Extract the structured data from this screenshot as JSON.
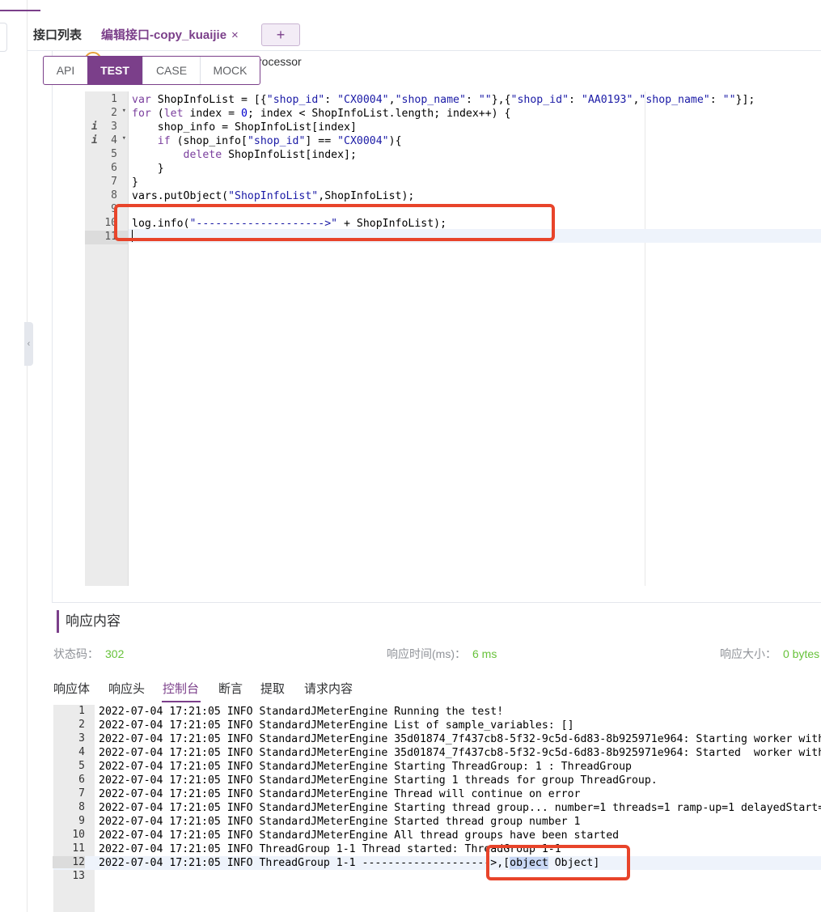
{
  "tabs": {
    "list_label": "接口列表",
    "edit_label": "编辑接口-copy_kuaijie",
    "close_glyph": "×",
    "add_glyph": "+"
  },
  "behind_text": "rocessor",
  "mode_tabs": [
    {
      "label": "API",
      "active": false
    },
    {
      "label": "TEST",
      "active": true
    },
    {
      "label": "CASE",
      "active": false
    },
    {
      "label": "MOCK",
      "active": false
    }
  ],
  "editor": {
    "line_numbers": [
      "1",
      "2",
      "3",
      "4",
      "5",
      "6",
      "7",
      "8",
      "9",
      "10",
      "11"
    ],
    "info_lines": [
      "3",
      "4"
    ],
    "fold_lines": [
      "2",
      "4"
    ],
    "lines": [
      "var ShopInfoList = [{\"shop_id\": \"CX0004\",\"shop_name\": \"\"},{\"shop_id\": \"AA0193\",\"shop_name\": \"\"}];",
      "for (let index = 0; index < ShopInfoList.length; index++) {",
      "    shop_info = ShopInfoList[index]",
      "    if (shop_info[\"shop_id\"] == \"CX0004\"){",
      "        delete ShopInfoList[index];",
      "    }",
      "}",
      "vars.putObject(\"ShopInfoList\",ShopInfoList);",
      "",
      "log.info(\"-------------------->\" + ShopInfoList);",
      ""
    ]
  },
  "response": {
    "title": "响应内容",
    "status_label": "状态码：",
    "status_value": "302",
    "time_label": "响应时间(ms)：",
    "time_value": "6 ms",
    "size_label": "响应大小：",
    "size_value": "0 bytes",
    "tabs": [
      "响应体",
      "响应头",
      "控制台",
      "断言",
      "提取",
      "请求内容"
    ],
    "active_tab": "控制台"
  },
  "console": {
    "lines": [
      "2022-07-04 17:21:05 INFO StandardJMeterEngine Running the test!",
      "2022-07-04 17:21:05 INFO StandardJMeterEngine List of sample_variables: []",
      "2022-07-04 17:21:05 INFO StandardJMeterEngine 35d01874_7f437cb8-5f32-9c5d-6d83-8b925971e964: Starting worker with",
      "2022-07-04 17:21:05 INFO StandardJMeterEngine 35d01874_7f437cb8-5f32-9c5d-6d83-8b925971e964: Started  worker with",
      "2022-07-04 17:21:05 INFO StandardJMeterEngine Starting ThreadGroup: 1 : ThreadGroup",
      "2022-07-04 17:21:05 INFO StandardJMeterEngine Starting 1 threads for group ThreadGroup.",
      "2022-07-04 17:21:05 INFO StandardJMeterEngine Thread will continue on error",
      "2022-07-04 17:21:05 INFO StandardJMeterEngine Starting thread group... number=1 threads=1 ramp-up=1 delayedStart=",
      "2022-07-04 17:21:05 INFO StandardJMeterEngine Started thread group number 1",
      "2022-07-04 17:21:05 INFO StandardJMeterEngine All thread groups have been started",
      "2022-07-04 17:21:05 INFO ThreadGroup 1-1 Thread started: ThreadGroup 1-1",
      "2022-07-04 17:21:05 INFO ThreadGroup 1-1 -------------------->,[object Object]",
      ""
    ],
    "line12_prefix": "2022-07-04 17:21:05 INFO ThreadGroup 1-1 -------------------->,[",
    "line12_selected": "object",
    "line12_suffix": " Object]"
  },
  "colors": {
    "brand": "#7b3f8a",
    "success": "#67c23a",
    "highlight": "#e8442a"
  }
}
